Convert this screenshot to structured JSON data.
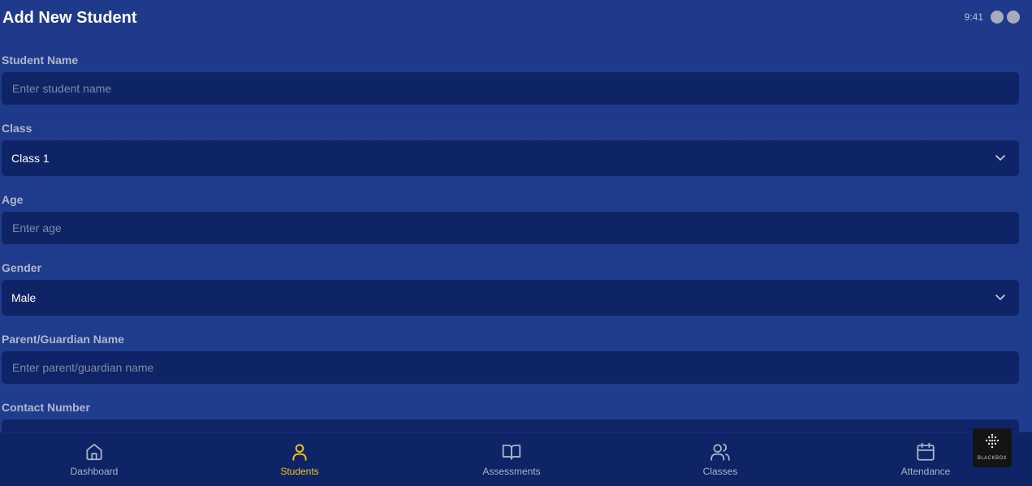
{
  "header": {
    "title": "Add New Student",
    "time": "9:41"
  },
  "form": {
    "student_name": {
      "label": "Student Name",
      "placeholder": "Enter student name",
      "value": ""
    },
    "class": {
      "label": "Class",
      "value": "Class 1"
    },
    "age": {
      "label": "Age",
      "placeholder": "Enter age",
      "value": ""
    },
    "gender": {
      "label": "Gender",
      "value": "Male"
    },
    "parent_name": {
      "label": "Parent/Guardian Name",
      "placeholder": "Enter parent/guardian name",
      "value": ""
    },
    "contact": {
      "label": "Contact Number"
    }
  },
  "nav": {
    "items": [
      {
        "label": "Dashboard",
        "icon": "home-icon",
        "active": false
      },
      {
        "label": "Students",
        "icon": "user-icon",
        "active": true
      },
      {
        "label": "Assessments",
        "icon": "book-open-icon",
        "active": false
      },
      {
        "label": "Classes",
        "icon": "users-icon",
        "active": false
      },
      {
        "label": "Attendance",
        "icon": "calendar-icon",
        "active": false
      }
    ]
  },
  "badge": {
    "text": "BLACKBOX",
    "icon": "blackbox-logo-icon"
  },
  "colors": {
    "background": "#1f3b8c",
    "field": "#0f2466",
    "nav": "#0f2466",
    "active": "#f5c518",
    "muted": "#a9b3c9"
  }
}
